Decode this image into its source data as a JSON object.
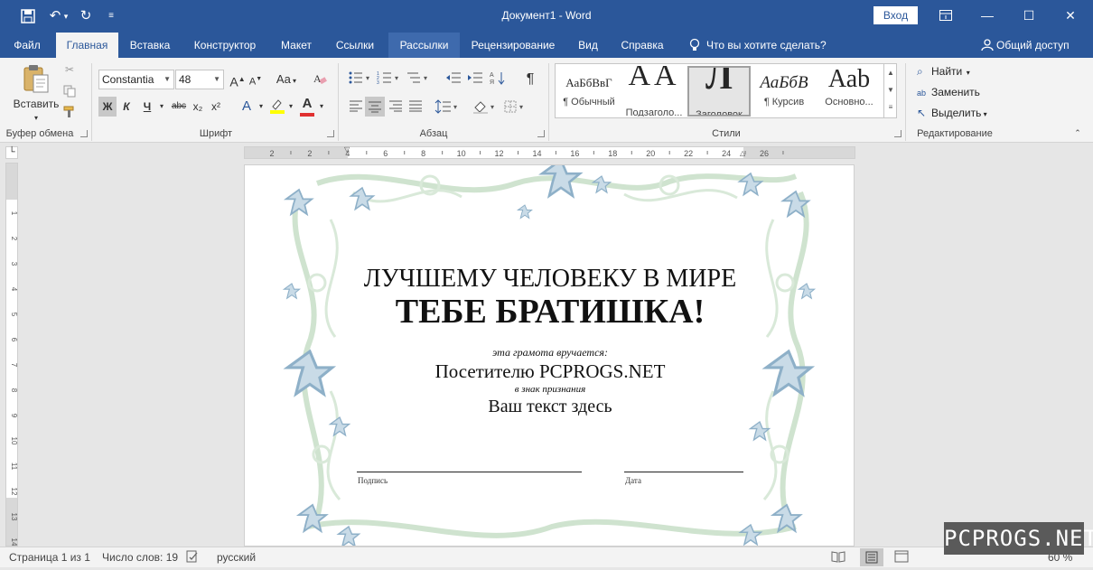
{
  "window": {
    "title": "Документ1 - Word",
    "signin_label": "Вход"
  },
  "tabs": [
    {
      "label": "Файл"
    },
    {
      "label": "Главная"
    },
    {
      "label": "Вставка"
    },
    {
      "label": "Конструктор"
    },
    {
      "label": "Макет"
    },
    {
      "label": "Ссылки"
    },
    {
      "label": "Рассылки"
    },
    {
      "label": "Рецензирование"
    },
    {
      "label": "Вид"
    },
    {
      "label": "Справка"
    }
  ],
  "tell_me": "Что вы хотите сделать?",
  "share": "Общий доступ",
  "clipboard": {
    "paste_label": "Вставить",
    "group_label": "Буфер обмена"
  },
  "font": {
    "group_label": "Шрифт",
    "font_name": "Constantia",
    "font_size": "48",
    "grow": "A",
    "shrink": "A",
    "case": "Aa",
    "bold": "Ж",
    "italic": "К",
    "underline": "Ч",
    "strike": "abc",
    "subscript": "x₂",
    "superscript": "x²",
    "effects": "A",
    "color": "A"
  },
  "paragraph": {
    "group_label": "Абзац",
    "pilcrow": "¶"
  },
  "styles": {
    "group_label": "Стили",
    "items": [
      {
        "preview": "АаБбВвГ",
        "name": "¶ Обычный"
      },
      {
        "preview": "АА",
        "name": "Подзаголо..."
      },
      {
        "preview": "Л",
        "name": "Заголовок"
      },
      {
        "preview": "АаБбВ",
        "name": "¶ Курсив"
      },
      {
        "preview": "Ааb",
        "name": "Основно..."
      }
    ]
  },
  "editing": {
    "group_label": "Редактирование",
    "find": "Найти",
    "replace": "Заменить",
    "select": "Выделить"
  },
  "ruler": {
    "h_ticks": [
      "2",
      "2",
      "4",
      "6",
      "8",
      "10",
      "12",
      "14",
      "16",
      "18",
      "20",
      "22",
      "24",
      "26"
    ],
    "v_ticks": [
      "1",
      "2",
      "3",
      "4",
      "5",
      "6",
      "7",
      "8",
      "9",
      "10",
      "11",
      "12",
      "13",
      "14"
    ]
  },
  "certificate": {
    "line1": "ЛУЧШЕМУ ЧЕЛОВЕКУ В МИРЕ",
    "line2": "ТЕБЕ БРАТИШКА!",
    "awarded_to_caption": "эта грамота вручается:",
    "recipient": "Посетителю PCPROGS.NET",
    "reason_caption": "в знак признания",
    "reason_text": "Ваш текст здесь",
    "signature_label": "Подпись",
    "date_label": "Дата"
  },
  "status": {
    "page": "Страница 1 из 1",
    "words": "Число слов: 19",
    "language": "русский",
    "zoom": "60 %"
  },
  "watermark": "PCPROGS.NET",
  "colors": {
    "accent": "#2b579a",
    "border_green": "#cfe3cf",
    "star_blue": "#a9c4d6"
  }
}
